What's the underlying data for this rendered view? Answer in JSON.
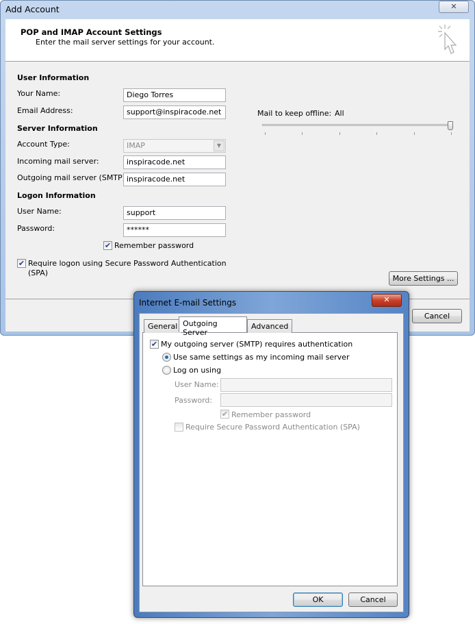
{
  "main": {
    "title": "Add Account",
    "header_title": "POP and IMAP Account Settings",
    "header_subtitle": "Enter the mail server settings for your account.",
    "user_info": "User Information",
    "your_name_label": "Your Name:",
    "your_name": "Diego Torres",
    "email_label": "Email Address:",
    "email": "support@inspiracode.net",
    "server_info": "Server Information",
    "account_type_label": "Account Type:",
    "account_type": "IMAP",
    "incoming_label": "Incoming mail server:",
    "incoming": "inspiracode.net",
    "outgoing_label": "Outgoing mail server (SMTP):",
    "outgoing": "inspiracode.net",
    "logon_info": "Logon Information",
    "username_label": "User Name:",
    "username": "support",
    "password_label": "Password:",
    "password": "******",
    "remember_password": "Remember password",
    "remember_checked": true,
    "spa_label": "Require logon using Secure Password Authentication (SPA)",
    "spa_checked": true,
    "offline_label": "Mail to keep offline:",
    "offline_value": "All",
    "offline_slider_fraction": 1.0,
    "more_settings": "More Settings ...",
    "cancel": "Cancel"
  },
  "dialog": {
    "title": "Internet E-mail Settings",
    "tabs": [
      "General",
      "Outgoing Server",
      "Advanced"
    ],
    "active_tab": "Outgoing Server",
    "smtp_auth": "My outgoing server (SMTP) requires authentication",
    "smtp_auth_checked": true,
    "same_settings": "Use same settings as my incoming mail server",
    "log_on_using": "Log on using",
    "username_label": "User Name:",
    "password_label": "Password:",
    "remember_password": "Remember password",
    "spa": "Require Secure Password Authentication (SPA)",
    "ok": "OK",
    "cancel": "Cancel"
  }
}
